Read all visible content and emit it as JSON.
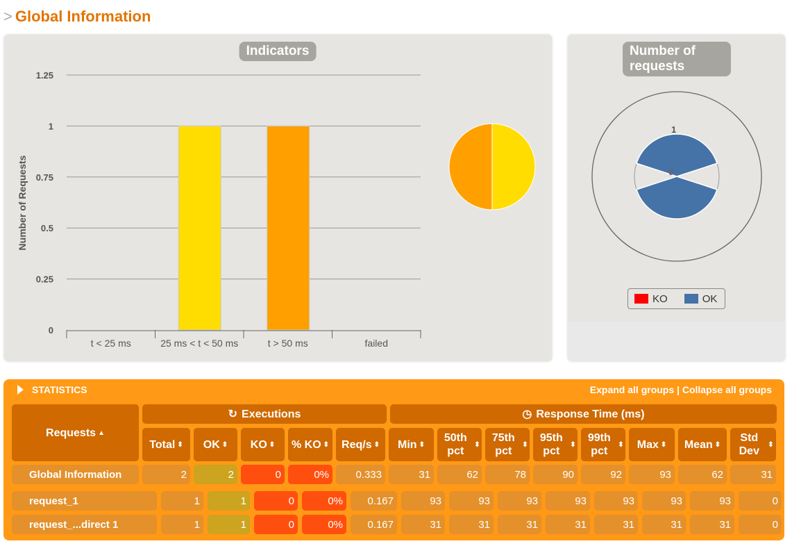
{
  "page_title": "Global Information",
  "indicators": {
    "title": "Indicators",
    "ylabel": "Number of Requests"
  },
  "chart_data": {
    "type": "bar",
    "categories": [
      "t < 25 ms",
      "25 ms < t < 50 ms",
      "t > 50 ms",
      "failed"
    ],
    "values": [
      0,
      1,
      1,
      0
    ],
    "colors": [
      "#ffdd00",
      "#ffdd00",
      "#ffa000",
      "#ff0000"
    ],
    "ylabel": "Number of Requests",
    "ylim": [
      0,
      1.25
    ],
    "yticks": [
      "0",
      "0.25",
      "0.5",
      "0.75",
      "1",
      "1.25"
    ],
    "grid": true,
    "pie": {
      "values": [
        1,
        1
      ],
      "colors": [
        "#ffa000",
        "#ffdd00"
      ]
    }
  },
  "requests_chart": {
    "title": "Number of requests",
    "ticks": [
      "0",
      "1"
    ],
    "legend": [
      {
        "label": "KO",
        "color": "#ff0000"
      },
      {
        "label": "OK",
        "color": "#4572a7"
      }
    ]
  },
  "statistics": {
    "title": "STATISTICS",
    "expand": "Expand all groups",
    "sep": "|",
    "collapse": "Collapse all groups",
    "groups": {
      "executions": "Executions",
      "response": "Response Time (ms)"
    },
    "requests_header": "Requests",
    "columns": [
      "Total",
      "OK",
      "KO",
      "% KO",
      "Req/s",
      "Min",
      "50th pct",
      "75th pct",
      "95th pct",
      "99th pct",
      "Max",
      "Mean",
      "Std Dev"
    ],
    "global": {
      "name": "Global Information",
      "values": [
        "2",
        "2",
        "0",
        "0%",
        "0.333",
        "31",
        "62",
        "78",
        "90",
        "92",
        "93",
        "62",
        "31"
      ]
    },
    "rows": [
      {
        "name": "request_1",
        "values": [
          "1",
          "1",
          "0",
          "0%",
          "0.167",
          "93",
          "93",
          "93",
          "93",
          "93",
          "93",
          "93",
          "0"
        ]
      },
      {
        "name": "request_...direct 1",
        "values": [
          "1",
          "1",
          "0",
          "0%",
          "0.167",
          "31",
          "31",
          "31",
          "31",
          "31",
          "31",
          "31",
          "0"
        ]
      }
    ]
  }
}
